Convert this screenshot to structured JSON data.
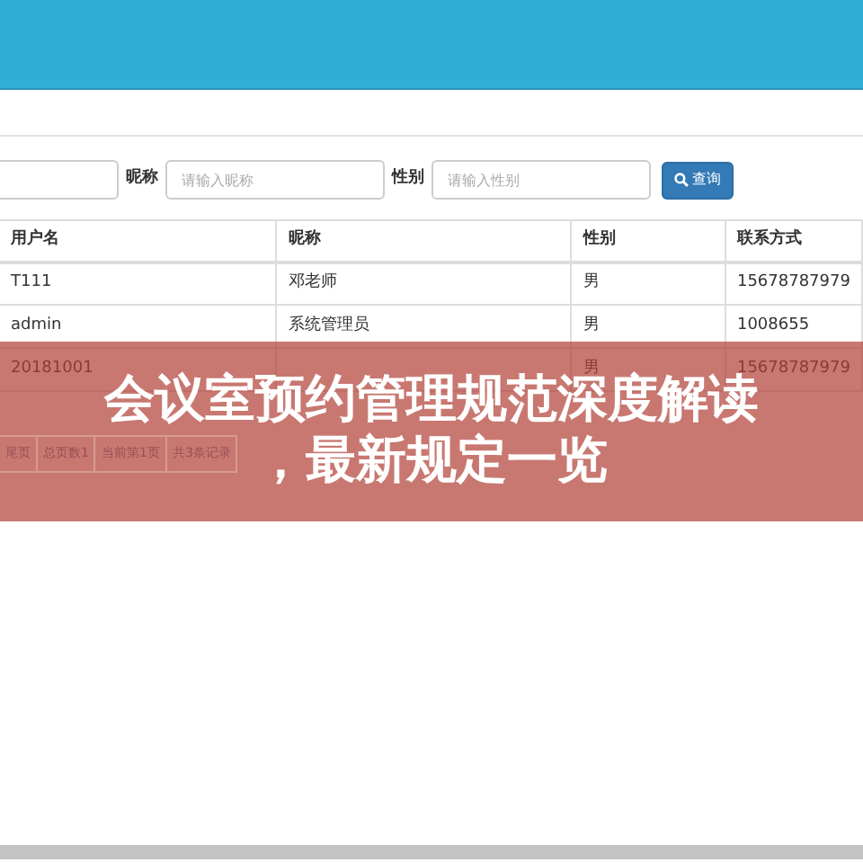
{
  "search": {
    "cut_field": true,
    "fields": [
      {
        "label": "昵称",
        "placeholder": "请输入昵称"
      },
      {
        "label": "性别",
        "placeholder": "请输入性别"
      }
    ],
    "button": "查询"
  },
  "table": {
    "columns": [
      "用户名",
      "昵称",
      "性别",
      "联系方式"
    ],
    "rows": [
      [
        "T111",
        "邓老师",
        "男",
        "15678787979"
      ],
      [
        "admin",
        "系统管理员",
        "男",
        "1008655"
      ],
      [
        "20181001",
        "",
        "男",
        "15678787979"
      ]
    ]
  },
  "pagination": [
    "尾页",
    "总页数1",
    "当前第1页",
    "共3条记录"
  ],
  "banner": {
    "title_lines": [
      "会议室预约管理规范深度解读",
      "，最新规定一览"
    ]
  }
}
